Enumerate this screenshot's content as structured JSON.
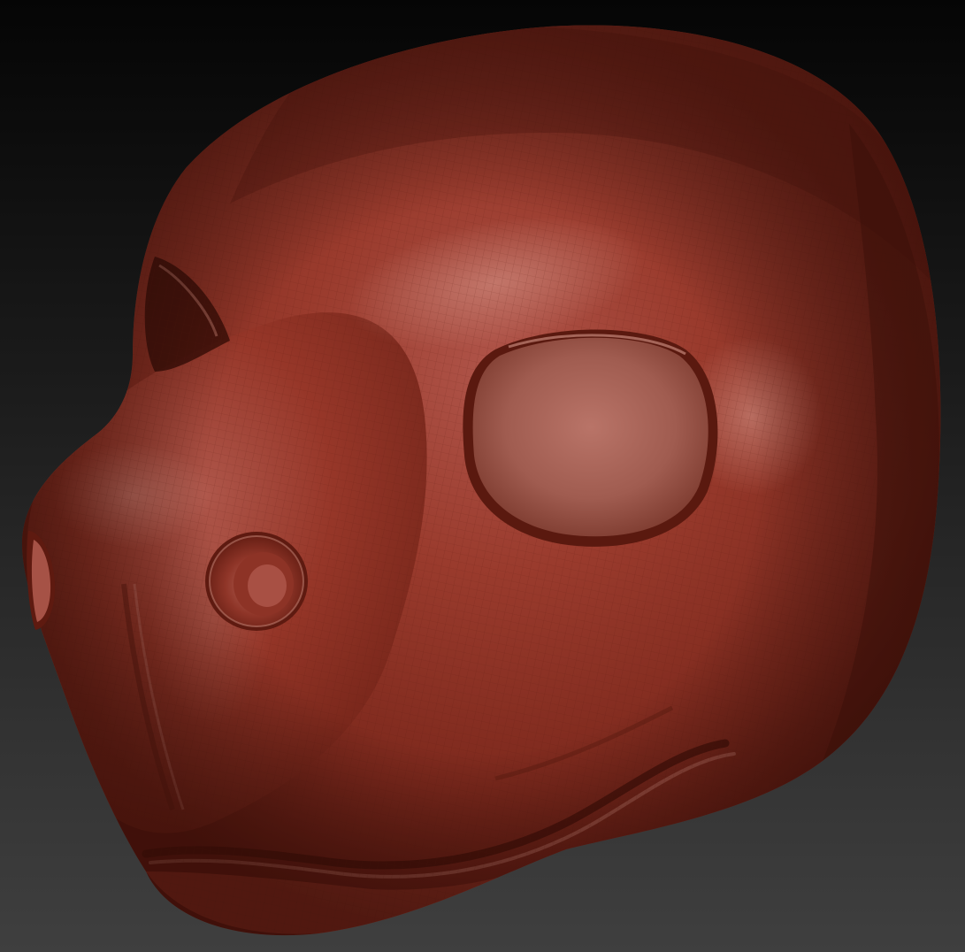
{
  "scene": {
    "subject": "sculpted-animal-head-model",
    "material_color": "#9a3a2c",
    "material_highlight": "#c07a6c",
    "material_shadow": "#4a140d",
    "background_top": "#050505",
    "background_bottom": "#3f3f3f",
    "wireframe_visible": true
  }
}
